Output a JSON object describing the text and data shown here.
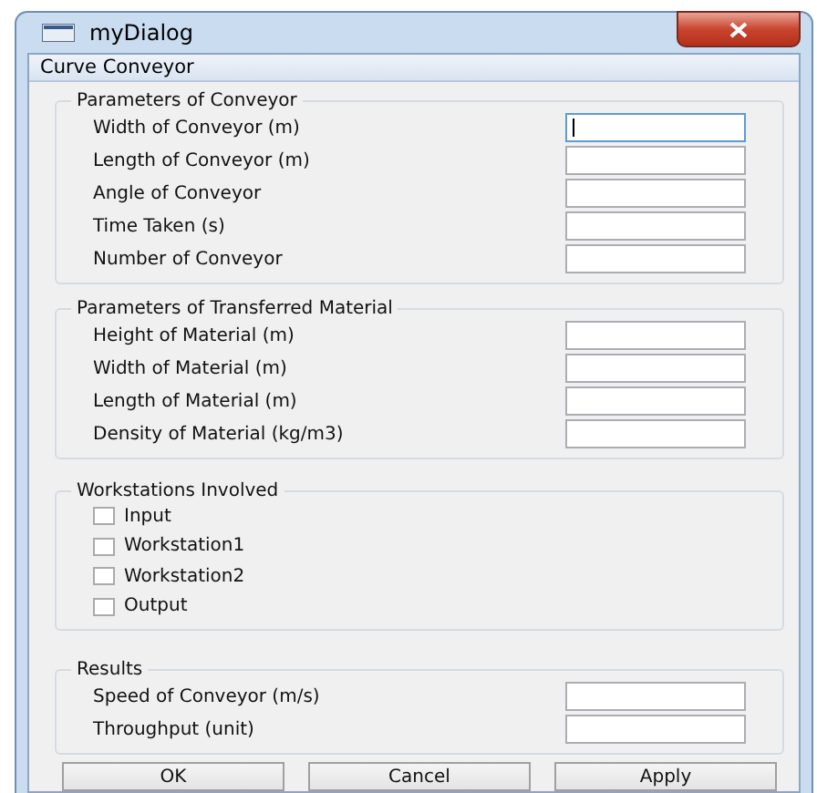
{
  "window": {
    "title": "myDialog"
  },
  "panel_title": "Curve Conveyor",
  "groups": [
    {
      "kind": "fields",
      "title": "Parameters of Conveyor",
      "items": [
        {
          "label": "Width of Conveyor (m)",
          "focused": true
        },
        {
          "label": "Length of Conveyor (m)",
          "focused": false
        },
        {
          "label": "Angle of Conveyor",
          "focused": false
        },
        {
          "label": "Time Taken (s)",
          "focused": false
        },
        {
          "label": "Number of Conveyor",
          "focused": false
        }
      ]
    },
    {
      "kind": "fields",
      "title": "Parameters of Transferred Material",
      "items": [
        {
          "label": "Height of Material (m)",
          "focused": false
        },
        {
          "label": "Width of Material (m)",
          "focused": false
        },
        {
          "label": "Length of Material (m)",
          "focused": false
        },
        {
          "label": "Density of Material (kg/m3)",
          "focused": false
        }
      ]
    },
    {
      "kind": "checks",
      "title": "Workstations Involved",
      "items": [
        {
          "label": "Input",
          "checked": false
        },
        {
          "label": "Workstation1",
          "checked": false
        },
        {
          "label": "Workstation2",
          "checked": false
        },
        {
          "label": "Output",
          "checked": false
        }
      ]
    },
    {
      "kind": "fields",
      "title": "Results",
      "items": [
        {
          "label": "Speed of Conveyor (m/s)",
          "focused": false
        },
        {
          "label": "Throughput (unit)",
          "focused": false
        }
      ]
    }
  ],
  "buttons": [
    "OK",
    "Cancel",
    "Apply"
  ]
}
